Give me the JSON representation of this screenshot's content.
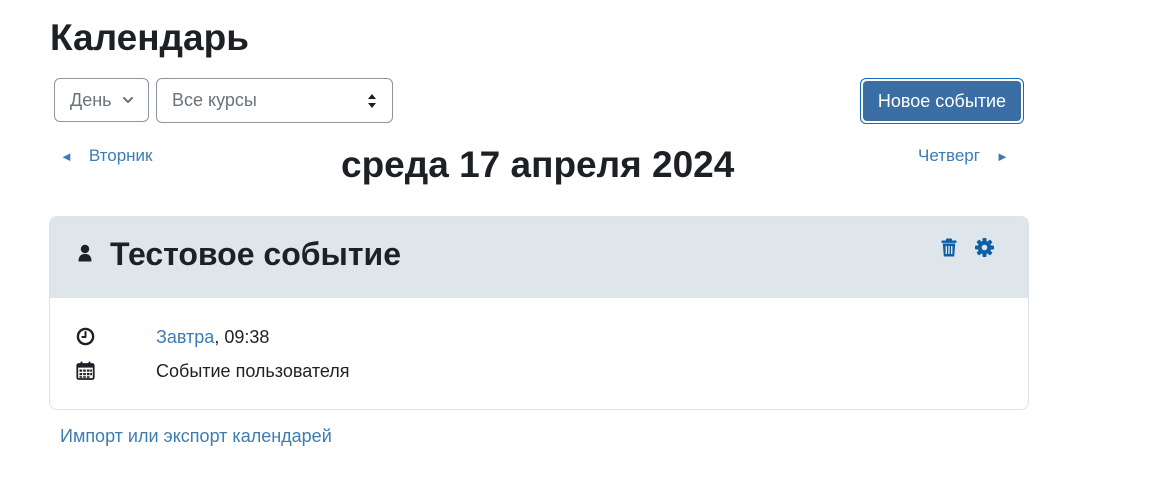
{
  "page": {
    "title": "Календарь"
  },
  "toolbar": {
    "view_select_value": "День",
    "course_select_value": "Все курсы",
    "new_event_label": "Новое событие"
  },
  "day_nav": {
    "prev_label": "Вторник",
    "current_date": "среда 17 апреля 2024",
    "next_label": "Четверг",
    "prev_arrow": "◄",
    "next_arrow": "►"
  },
  "event": {
    "title": "Тестовое событие",
    "time_link": "Завтра",
    "time_rest": ", 09:38",
    "type": "Событие пользователя",
    "icons": [
      "user-icon",
      "trash-icon",
      "gear-icon",
      "clock-icon",
      "calendar-icon"
    ]
  },
  "footer": {
    "import_export_label": "Импорт или экспорт календарей"
  },
  "colors": {
    "link": "#3c7cb3",
    "primary_button": "#3a6ea5",
    "icon_blue": "#0f5fa8",
    "card_header_bg": "#dee6eb",
    "text": "#1d2125"
  }
}
